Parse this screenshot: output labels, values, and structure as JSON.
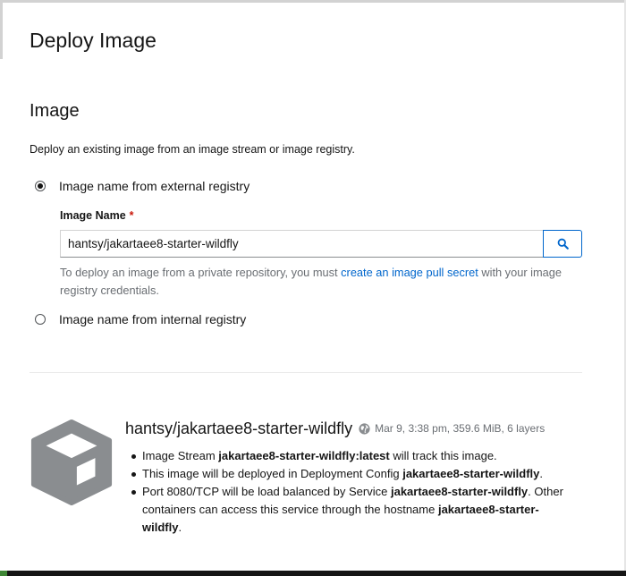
{
  "page": {
    "title": "Deploy Image"
  },
  "image_section": {
    "title": "Image",
    "description": "Deploy an existing image from an image stream or image registry."
  },
  "source_options": [
    {
      "label": "Image name from external registry",
      "selected": true
    },
    {
      "label": "Image name from internal registry",
      "selected": false
    }
  ],
  "image_name_field": {
    "label": "Image Name",
    "required_marker": "*",
    "value": "hantsy/jakartaee8-starter-wildfly",
    "search_icon": "search-icon",
    "helper_prefix": "To deploy an image from a private repository, you must ",
    "helper_link": "create an image pull secret",
    "helper_suffix": " with your image registry credentials."
  },
  "image_details": {
    "icon": "cube-icon",
    "name": "hantsy/jakartaee8-starter-wildfly",
    "meta_icon": "globe-icon",
    "meta": "Mar 9, 3:38 pm, 359.6 MiB, 6 layers",
    "items": [
      {
        "pre": "Image Stream ",
        "bold": "jakartaee8-starter-wildfly:latest",
        "post": " will track this image.",
        "bold2": "",
        "post2": ""
      },
      {
        "pre": "This image will be deployed in Deployment Config ",
        "bold": "jakartaee8-starter-wildfly",
        "post": ".",
        "bold2": "",
        "post2": ""
      },
      {
        "pre": "Port 8080/TCP will be load balanced by Service ",
        "bold": "jakartaee8-starter-wildfly",
        "post": ". Other containers can access this service through the hostname ",
        "bold2": "jakartaee8-starter-wildfly",
        "post2": "."
      }
    ]
  },
  "colors": {
    "link": "#0066cc",
    "required": "#c9190b",
    "icon_gray": "#8a8d90"
  }
}
